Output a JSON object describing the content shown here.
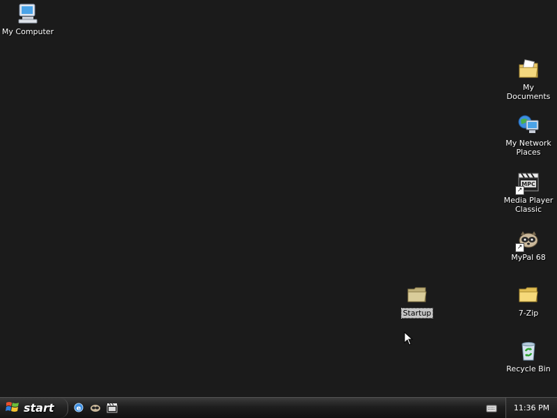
{
  "desktop": {
    "icons": [
      {
        "label": "My Computer",
        "icon": "computer-icon"
      },
      {
        "label": "My Documents",
        "icon": "documents-folder-icon"
      },
      {
        "label": "My Network Places",
        "icon": "network-icon"
      },
      {
        "label": "Media Player Classic",
        "icon": "media-player-icon"
      },
      {
        "label": "MyPal 68",
        "icon": "mypal-icon"
      },
      {
        "label": "7-Zip",
        "icon": "folder-icon"
      },
      {
        "label": "Recycle Bin",
        "icon": "recycle-bin-icon"
      },
      {
        "label": "Startup",
        "icon": "folder-icon",
        "selected": true
      }
    ]
  },
  "taskbar": {
    "start_label": "start",
    "quick_launch": [
      "ie-icon",
      "mypal-icon",
      "media-player-icon"
    ],
    "clock": "11:36 PM"
  }
}
